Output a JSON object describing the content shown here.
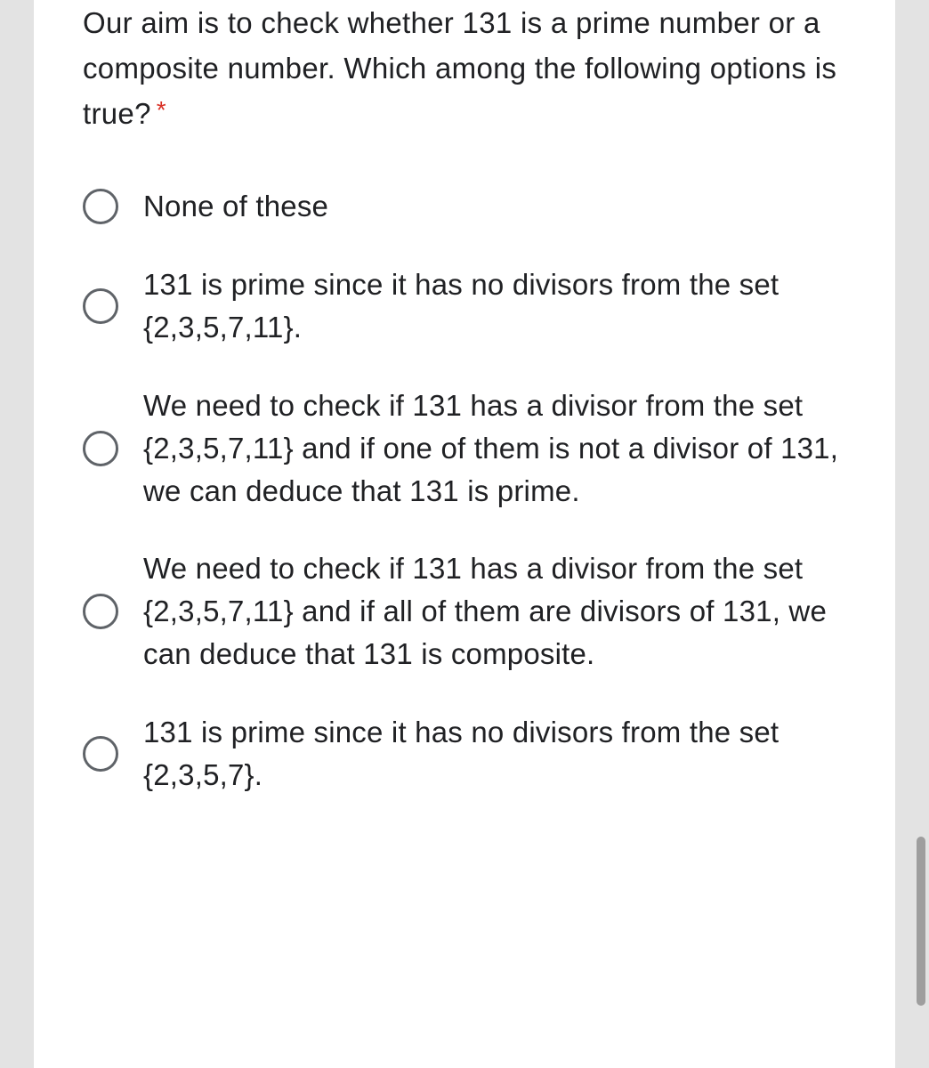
{
  "question": {
    "text": "Our aim is to check whether 131 is a prime number or a composite number. Which among the following options is true?",
    "required_marker": "*"
  },
  "options": [
    {
      "label": "None of these"
    },
    {
      "label": "131 is prime since it has no divisors from the set {2,3,5,7,11}."
    },
    {
      "label": "We need to check if 131 has a divisor from the set {2,3,5,7,11} and if one of them is not a divisor of 131, we can deduce that 131 is prime."
    },
    {
      "label": "We need to check if 131 has a divisor from the set {2,3,5,7,11} and if all of them are divisors of 131, we can deduce that 131 is composite."
    },
    {
      "label": "131 is prime since it has no divisors from the set {2,3,5,7}."
    }
  ]
}
